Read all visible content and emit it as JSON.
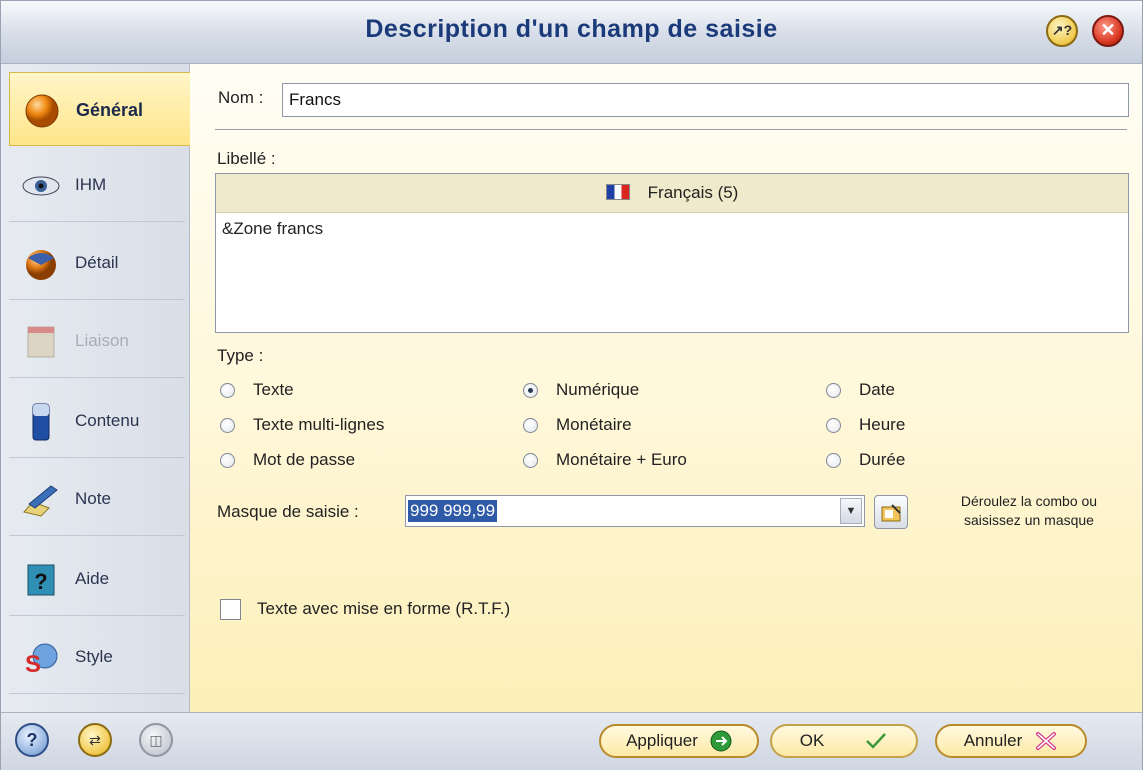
{
  "window": {
    "title": "Description d'un champ de saisie"
  },
  "sidebar": {
    "items": [
      {
        "label": "Général",
        "icon": "orange-ball-icon",
        "active": true
      },
      {
        "label": "IHM",
        "icon": "eye-icon"
      },
      {
        "label": "Détail",
        "icon": "detail-sphere-icon"
      },
      {
        "label": "Liaison",
        "icon": "link-table-icon",
        "disabled": true
      },
      {
        "label": "Contenu",
        "icon": "database-cylinder-icon"
      },
      {
        "label": "Note",
        "icon": "note-pen-icon"
      },
      {
        "label": "Aide",
        "icon": "help-book-icon"
      },
      {
        "label": "Style",
        "icon": "style-palette-icon"
      }
    ]
  },
  "form": {
    "nom_label": "Nom :",
    "nom_value": "Francs",
    "libelle_label": "Libellé :",
    "libelle_language": "Français (5)",
    "libelle_text": "&Zone francs",
    "type_label": "Type :",
    "types": {
      "texte": "Texte",
      "texte_multi": "Texte multi-lignes",
      "mot_de_passe": "Mot de passe",
      "numerique": "Numérique",
      "monetaire": "Monétaire",
      "monetaire_euro": "Monétaire + Euro",
      "date": "Date",
      "heure": "Heure",
      "duree": "Durée"
    },
    "selected_type": "Numérique",
    "masque_label": "Masque de saisie :",
    "masque_value": "999 999,99",
    "masque_hint_line1": "Déroulez la combo ou",
    "masque_hint_line2": "saisissez un masque",
    "rtf_label": "Texte avec mise en forme (R.T.F.)",
    "rtf_checked": false
  },
  "buttons": {
    "appliquer": "Appliquer",
    "ok": "OK",
    "annuler": "Annuler"
  },
  "colors": {
    "title": "#1b3a7a",
    "panel_bg": "#fff7d8",
    "active_tab": "#ffe58a",
    "selection": "#2f5aa8"
  }
}
